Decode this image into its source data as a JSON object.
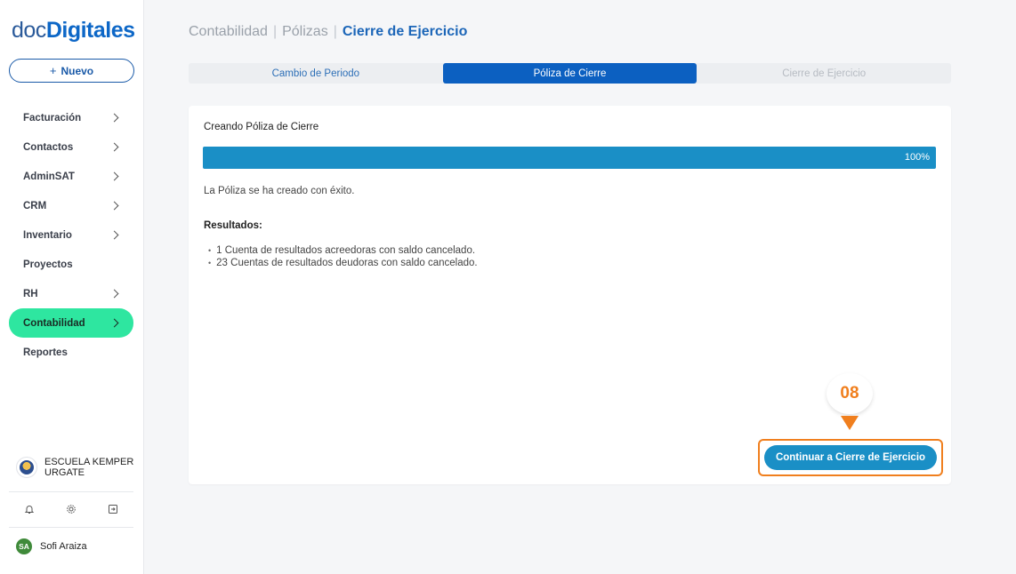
{
  "logo": {
    "light": "doc",
    "bold": "Digitales"
  },
  "sidebar": {
    "new_button": "Nuevo",
    "items": [
      {
        "label": "Facturación",
        "chevron": true
      },
      {
        "label": "Contactos",
        "chevron": true
      },
      {
        "label": "AdminSAT",
        "chevron": true
      },
      {
        "label": "CRM",
        "chevron": true
      },
      {
        "label": "Inventario",
        "chevron": true
      },
      {
        "label": "Proyectos",
        "chevron": false
      },
      {
        "label": "RH",
        "chevron": true
      },
      {
        "label": "Contabilidad",
        "chevron": true,
        "active": true
      },
      {
        "label": "Reportes",
        "chevron": false
      }
    ],
    "organization": "ESCUELA KEMPER URGATE",
    "footer_icons": [
      "bell-icon",
      "gear-icon",
      "logout-icon"
    ],
    "user": {
      "initials": "SA",
      "name": "Sofi Araiza"
    }
  },
  "breadcrumb": {
    "part1": "Contabilidad",
    "part2": "Pólizas",
    "current": "Cierre de Ejercicio"
  },
  "steps": [
    {
      "label": "Cambio de Periodo",
      "state": "done"
    },
    {
      "label": "Póliza de Cierre",
      "state": "active"
    },
    {
      "label": "Cierre de Ejercicio",
      "state": "disabled"
    }
  ],
  "card": {
    "title": "Creando Póliza de Cierre",
    "progress_percent": 100,
    "progress_label": "100%",
    "success_message": "La Póliza se ha creado con éxito.",
    "results_title": "Resultados:",
    "results": [
      "1 Cuenta de resultados acreedoras con saldo cancelado.",
      "23 Cuentas de resultados deudoras con saldo cancelado."
    ],
    "continue_button": "Continuar a Cierre de Ejercicio"
  },
  "annotation": {
    "step_number": "08"
  },
  "colors": {
    "accent": "#1a8fc6",
    "active_nav": "#2ee6a0",
    "highlight": "#f07f1e",
    "brand": "#0c60c1"
  }
}
